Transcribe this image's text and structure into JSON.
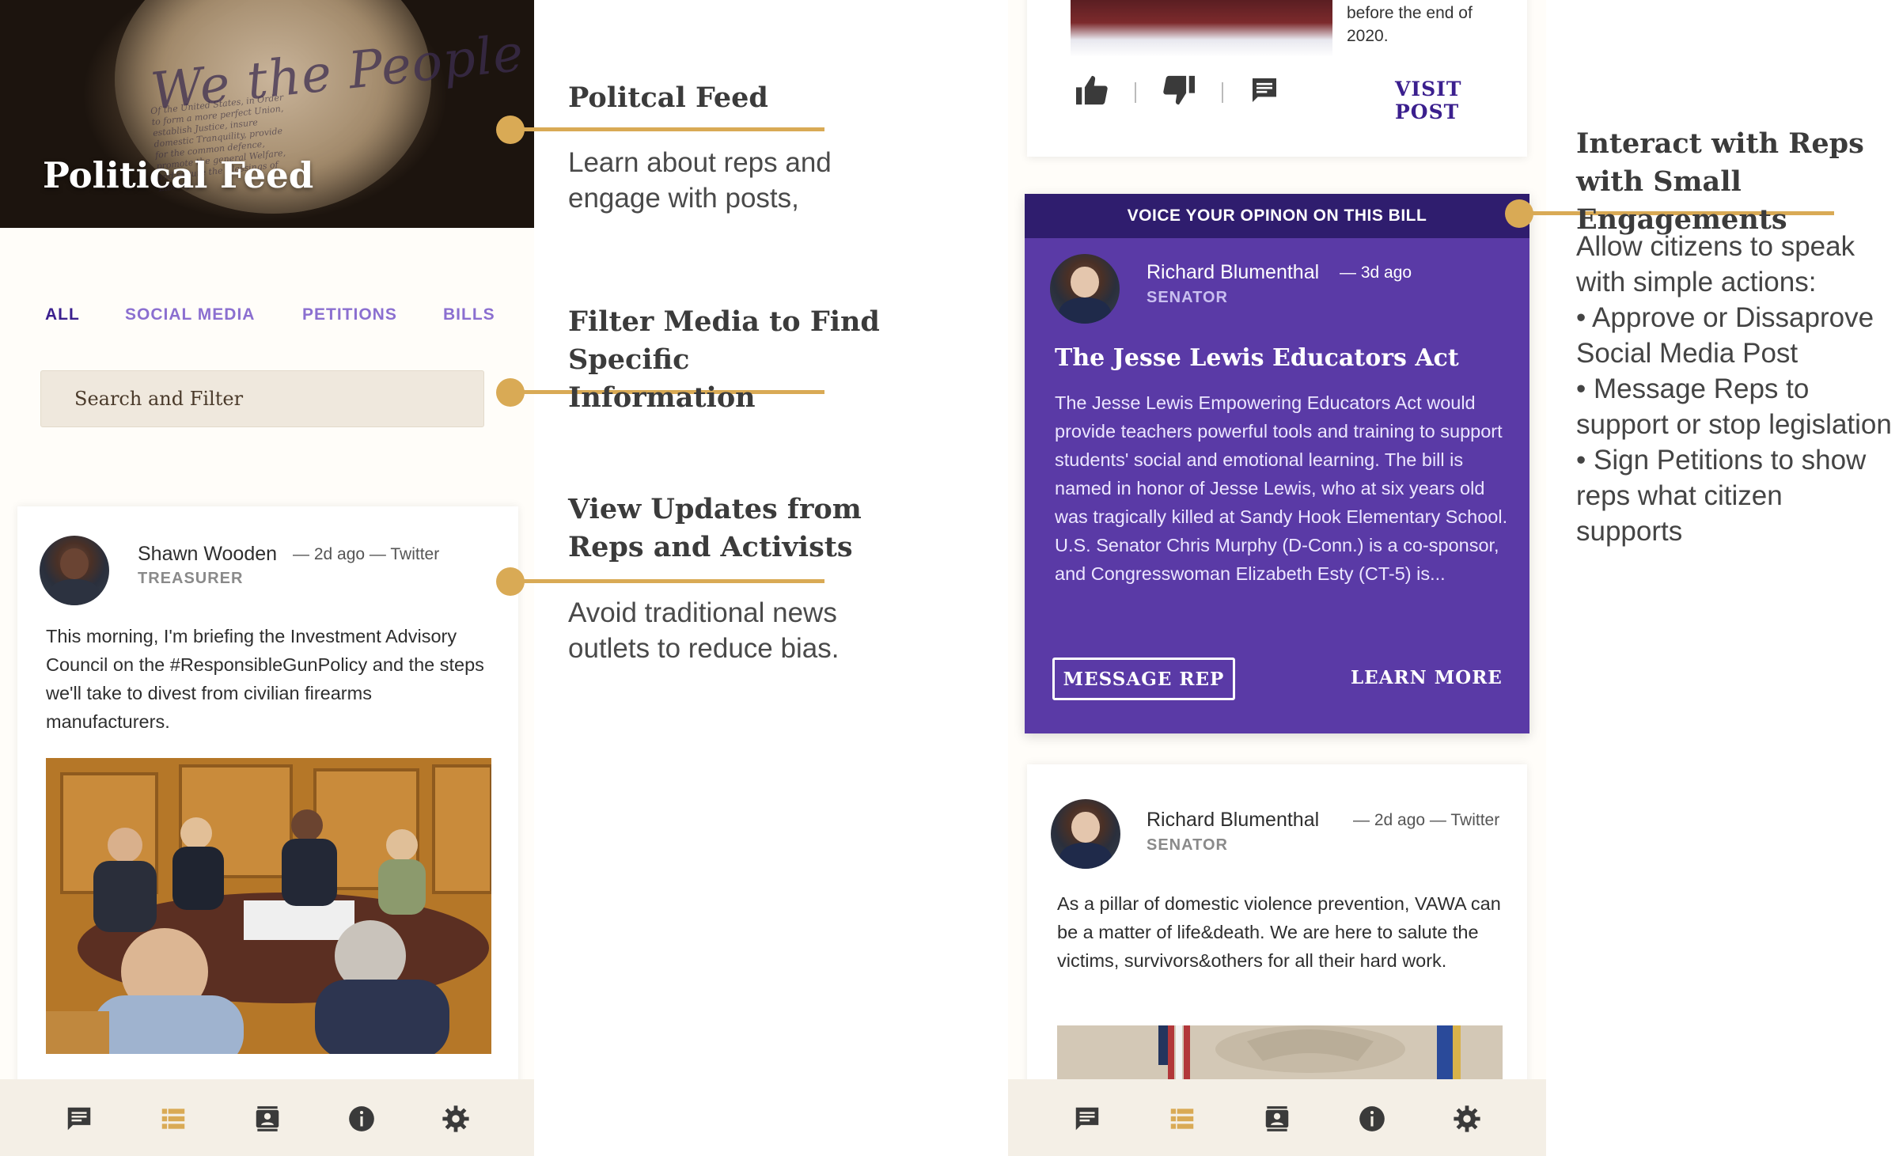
{
  "left_screen": {
    "hero": {
      "title": "Political Feed",
      "image_script": "We the People",
      "image_fineprint": "Of the United States, in Order to form a more perfect Union, establish Justice, insure domestic Tranquility, provide for the common defence, promote the general Welfare, and secure the Blessings of Liberty"
    },
    "tabs": [
      {
        "label": "ALL",
        "active": true
      },
      {
        "label": "SOCIAL MEDIA",
        "active": false
      },
      {
        "label": "PETITIONS",
        "active": false
      },
      {
        "label": "BILLS",
        "active": false
      }
    ],
    "search": {
      "placeholder": "Search and Filter"
    },
    "post": {
      "name": "Shawn Wooden",
      "meta": "— 2d ago — Twitter",
      "role": "TREASURER",
      "text": "This morning, I'm briefing the Investment Advisory Council on the #ResponsibleGunPolicy and the steps we'll take to divest from civilian firearms manufacturers."
    },
    "tabbar": [
      "chat-icon",
      "feed-icon",
      "contacts-icon",
      "info-icon",
      "settings-icon"
    ]
  },
  "annotations": [
    {
      "title": "Politcal Feed",
      "body": "Learn about reps and engage with posts,"
    },
    {
      "title": "Filter Media to Find Specific Information",
      "body": ""
    },
    {
      "title": "View Updates from Reps and Activists",
      "body": "Avoid traditional news outlets to reduce bias."
    }
  ],
  "right_screen": {
    "top_post": {
      "text": "before the end of 2020.",
      "visit_label": "VISIT POST"
    },
    "bill_card": {
      "banner": "VOICE YOUR OPINON ON THIS BILL",
      "name": "Richard Blumenthal",
      "meta": "— 3d ago",
      "role": "SENATOR",
      "title": "The Jesse Lewis Educators Act",
      "description": "The Jesse Lewis Empowering Educators Act would provide teachers powerful tools and training to support students' social and emotional learning. The bill is named in honor of Jesse Lewis, who at six years old was tragically killed at Sandy Hook Elementary School. U.S. Senator Chris Murphy (D-Conn.) is a co-sponsor, and Congresswoman Elizabeth Esty (CT-5) is...",
      "message_label": "MESSAGE REP",
      "learn_label": "LEARN MORE"
    },
    "post": {
      "name": "Richard Blumenthal",
      "meta": "— 2d ago — Twitter",
      "role": "SENATOR",
      "text": "As a pillar of domestic violence prevention, VAWA can be a matter of life&death. We are here to salute the victims, survivors&others for all their hard work."
    }
  },
  "right_annotation": {
    "title": "Interact with Reps with Small Engagements",
    "intro": "Allow citizens to speak with simple actions:",
    "bullets": [
      "• Approve or Dissaprove Social Media Post",
      "• Message Reps to support or stop legislation",
      "• Sign Petitions to show reps what citizen supports"
    ]
  },
  "colors": {
    "accent_gold": "#d9aa55",
    "brand_purple": "#3b1f8e",
    "card_purple": "#5a3aa6",
    "banner_purple": "#2f1d6e",
    "tab_inactive": "#8b6fd0",
    "search_bg": "#efe8dd"
  }
}
